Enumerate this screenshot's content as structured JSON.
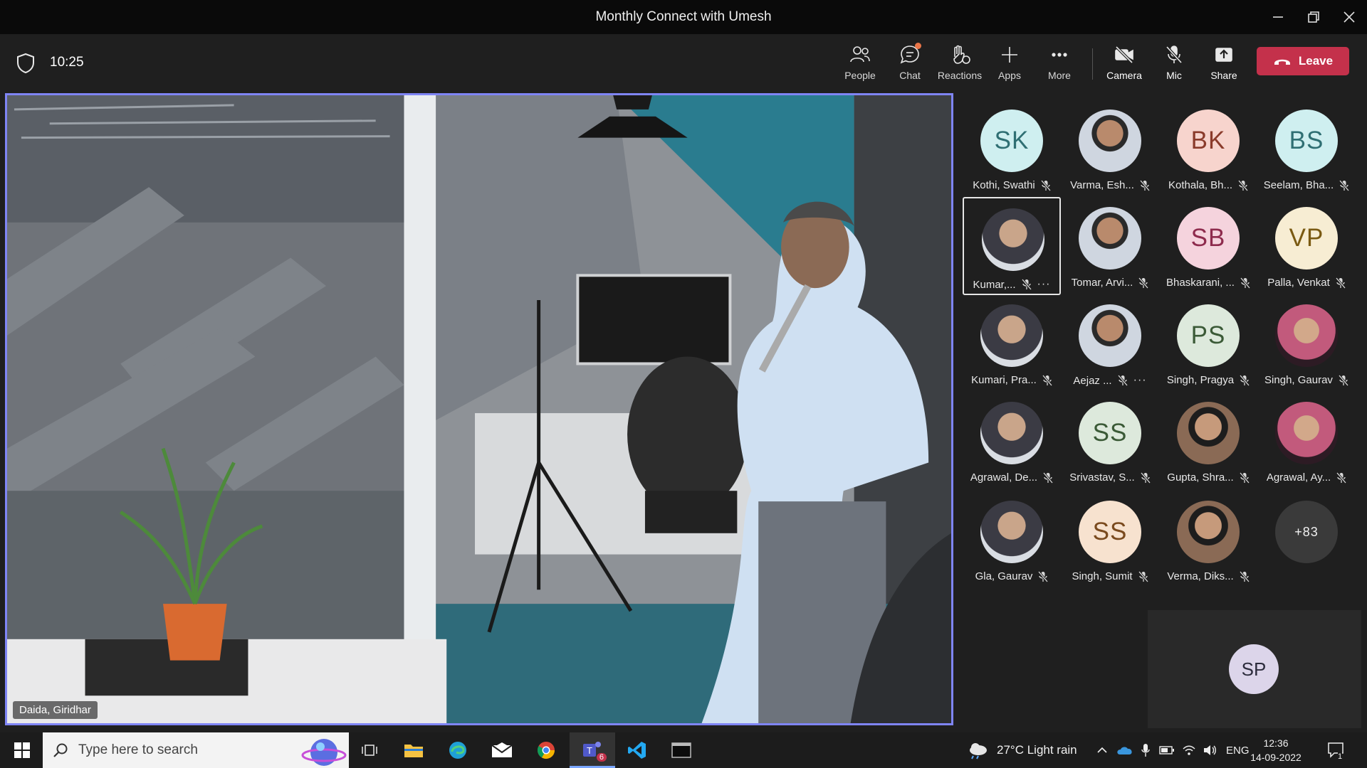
{
  "window": {
    "title": "Monthly Connect with Umesh"
  },
  "meeting": {
    "elapsed": "10:25",
    "toolbar": {
      "people": "People",
      "chat": "Chat",
      "reactions": "Reactions",
      "apps": "Apps",
      "more": "More",
      "camera": "Camera",
      "mic": "Mic",
      "share": "Share",
      "leave": "Leave"
    },
    "main_speaker": "Daida, Giridhar",
    "participants": [
      {
        "name": "Kothi, Swathi",
        "initials": "SK",
        "bg": "#cfeff0",
        "fg": "#2f6f73",
        "muted": true
      },
      {
        "name": "Varma, Esh...",
        "initials": "",
        "bg": "#b98a6c",
        "fg": "#fff",
        "muted": true
      },
      {
        "name": "Kothala, Bh...",
        "initials": "BK",
        "bg": "#f7d4cd",
        "fg": "#8a3b2b",
        "muted": true
      },
      {
        "name": "Seelam, Bha...",
        "initials": "BS",
        "bg": "#cfeff0",
        "fg": "#2f6f73",
        "muted": true
      },
      {
        "name": "Kumar,...",
        "initials": "",
        "bg": "#c9a58a",
        "fg": "#fff",
        "muted": true,
        "active": true,
        "more": "···"
      },
      {
        "name": "Tomar, Arvi...",
        "initials": "",
        "bg": "#b98a6c",
        "fg": "#fff",
        "muted": true
      },
      {
        "name": "Bhaskarani, ...",
        "initials": "SB",
        "bg": "#f5d3dd",
        "fg": "#8e2b4d",
        "muted": true
      },
      {
        "name": "Palla, Venkat",
        "initials": "VP",
        "bg": "#f7edd3",
        "fg": "#7a5a12",
        "muted": true
      },
      {
        "name": "Kumari, Pra...",
        "initials": "",
        "bg": "#3a2a2a",
        "fg": "#fff",
        "muted": true
      },
      {
        "name": "Aejaz ...",
        "initials": "",
        "bg": "#c69a7b",
        "fg": "#fff",
        "muted": true,
        "more": "···"
      },
      {
        "name": "Singh, Pragya",
        "initials": "PS",
        "bg": "#dde9dc",
        "fg": "#3b5a37",
        "muted": true
      },
      {
        "name": "Singh, Gaurav",
        "initials": "",
        "bg": "#8a6a55",
        "fg": "#fff",
        "muted": true
      },
      {
        "name": "Agrawal, De...",
        "initials": "",
        "bg": "#c9a58a",
        "fg": "#fff",
        "muted": true
      },
      {
        "name": "Srivastav, S...",
        "initials": "SS",
        "bg": "#dde9dc",
        "fg": "#3b5a37",
        "muted": true
      },
      {
        "name": "Gupta, Shra...",
        "initials": "",
        "bg": "#a88c6d",
        "fg": "#fff",
        "muted": true
      },
      {
        "name": "Agrawal, Ay...",
        "initials": "",
        "bg": "#c25a7c",
        "fg": "#fff",
        "muted": true
      },
      {
        "name": "Gla, Gaurav",
        "initials": "",
        "bg": "#c9a58a",
        "fg": "#fff",
        "muted": true
      },
      {
        "name": "Singh, Sumit",
        "initials": "SS",
        "bg": "#f7e2cf",
        "fg": "#7a4a1e",
        "muted": true
      },
      {
        "name": "Verma, Diks...",
        "initials": "",
        "bg": "#c25a7c",
        "fg": "#fff",
        "muted": true
      },
      {
        "name": "",
        "initials": "+83",
        "bg": "#3a3a3a",
        "fg": "#f0f0f0",
        "muted": false,
        "overflow": true
      }
    ],
    "self_initials": "SP"
  },
  "taskbar": {
    "search_placeholder": "Type here to search",
    "teams_badge": "6",
    "weather": "27°C  Light rain",
    "lang": "ENG",
    "time": "12:36",
    "date": "14-09-2022",
    "notif_count": "1"
  },
  "colors": {
    "accent": "#7f85f5",
    "leave": "#c4314b"
  }
}
